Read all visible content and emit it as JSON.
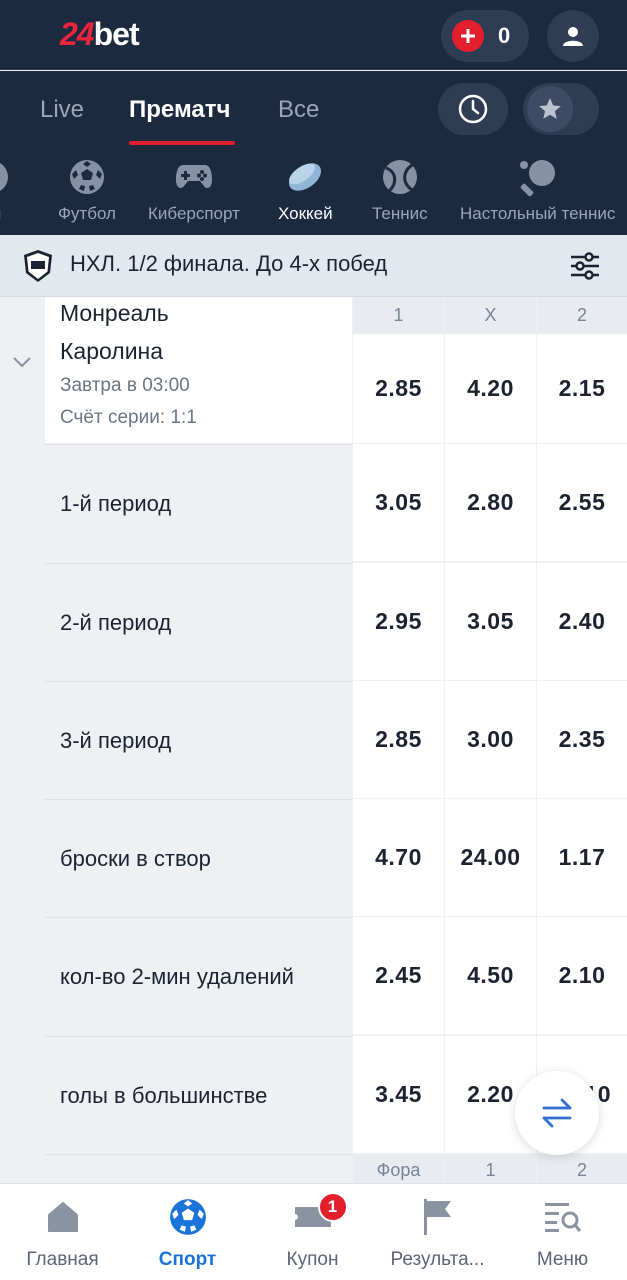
{
  "header": {
    "logo_num": "24",
    "logo_text": "bet",
    "coupon_count": "0"
  },
  "tabs": [
    {
      "label": "Live"
    },
    {
      "label": "Прематч"
    },
    {
      "label": "Все"
    }
  ],
  "sports": [
    {
      "label": "оп",
      "icon": "sport-icon"
    },
    {
      "label": "Футбол",
      "icon": "football-icon"
    },
    {
      "label": "Киберспорт",
      "icon": "gamepad-icon"
    },
    {
      "label": "Хоккей",
      "icon": "hockey-puck-icon"
    },
    {
      "label": "Теннис",
      "icon": "tennis-ball-icon"
    },
    {
      "label": "Настольный теннис",
      "icon": "table-tennis-icon"
    }
  ],
  "league": {
    "title": "НХЛ. 1/2 финала. До 4-х побед"
  },
  "event": {
    "team1": "Монреаль",
    "team2": "Каролина",
    "time": "Завтра в 03:00",
    "series": "Счёт серии: 1:1"
  },
  "columns": [
    "1",
    "X",
    "2"
  ],
  "main_odds": [
    "2.85",
    "4.20",
    "2.15"
  ],
  "markets": [
    {
      "label": "1-й период",
      "odds": [
        "3.05",
        "2.80",
        "2.55"
      ]
    },
    {
      "label": "2-й период",
      "odds": [
        "2.95",
        "3.05",
        "2.40"
      ]
    },
    {
      "label": "3-й период",
      "odds": [
        "2.85",
        "3.00",
        "2.35"
      ]
    },
    {
      "label": "броски в створ",
      "odds": [
        "4.70",
        "24.00",
        "1.17"
      ]
    },
    {
      "label": "кол-во 2-мин удалений",
      "odds": [
        "2.45",
        "4.50",
        "2.10"
      ]
    },
    {
      "label": "голы в большинстве",
      "odds": [
        "3.45",
        "2.20",
        ".10"
      ]
    }
  ],
  "next_columns": [
    "Фора",
    "1",
    "2"
  ],
  "bottom_nav": [
    {
      "label": "Главная",
      "icon": "home-icon"
    },
    {
      "label": "Спорт",
      "icon": "sport-ball-icon"
    },
    {
      "label": "Купон",
      "icon": "ticket-icon",
      "badge": "1"
    },
    {
      "label": "Результа...",
      "icon": "flag-icon"
    },
    {
      "label": "Меню",
      "icon": "menu-icon"
    }
  ],
  "colors": {
    "header_bg": "#1c2a40",
    "accent_red": "#e31e2d",
    "active_blue": "#1a73d9"
  }
}
